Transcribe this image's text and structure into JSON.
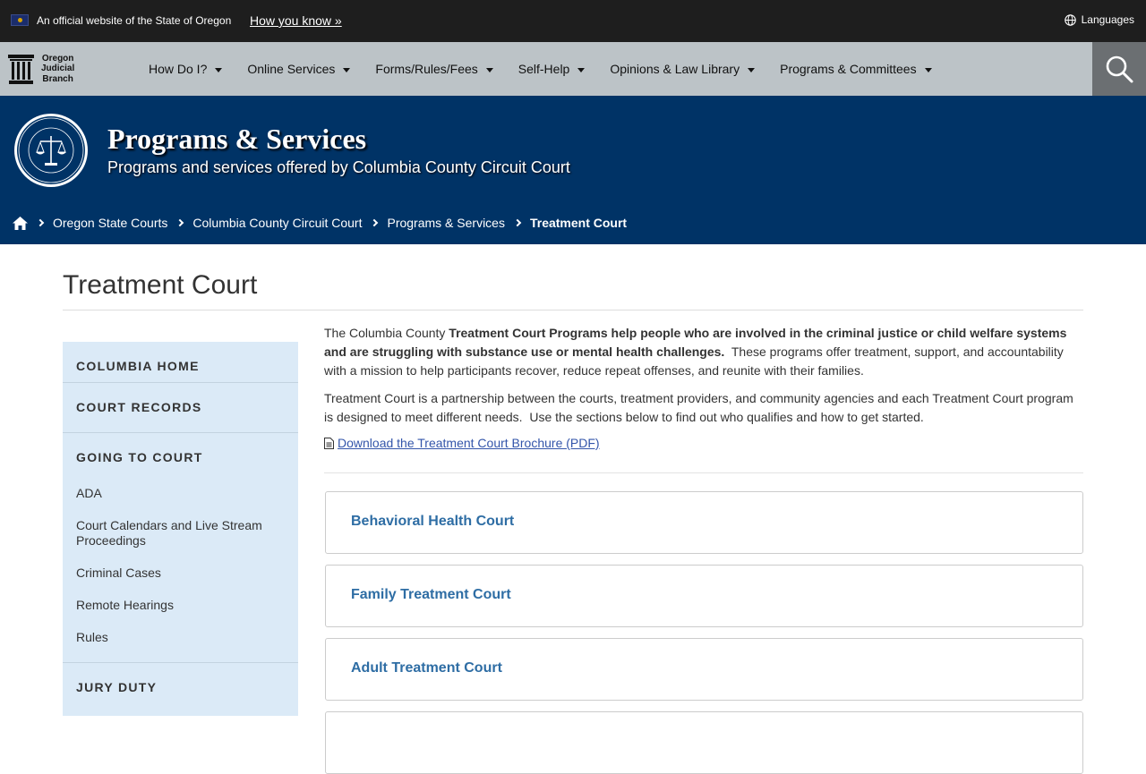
{
  "banner": {
    "official_text": "An official website of the State of Oregon",
    "how_link": "How you know »",
    "languages": "Languages"
  },
  "logo": {
    "line1": "Oregon",
    "line2": "Judicial",
    "line3": "Branch"
  },
  "nav": {
    "items": [
      {
        "label": "How Do I?"
      },
      {
        "label": "Online Services"
      },
      {
        "label": "Forms/Rules/Fees"
      },
      {
        "label": "Self-Help"
      },
      {
        "label": "Opinions & Law Library"
      },
      {
        "label": "Programs & Committees"
      }
    ]
  },
  "hero": {
    "title": "Programs & Services",
    "subtitle": "Programs and services offered by Columbia County Circuit Court"
  },
  "breadcrumb": {
    "items": [
      "Oregon State Courts",
      "Columbia County Circuit Court",
      "Programs & Services"
    ],
    "current": "Treatment Court"
  },
  "page": {
    "title": "Treatment Court"
  },
  "sidebar": {
    "columbia_home": "COLUMBIA HOME",
    "court_records": "COURT RECORDS",
    "going_to_court": "GOING TO COURT",
    "links": [
      "ADA",
      "Court Calendars and Live Stream Proceedings",
      "Criminal Cases",
      "Remote Hearings",
      "Rules"
    ],
    "jury_duty": "JURY DUTY"
  },
  "content": {
    "p1_pre": "The Columbia County ",
    "p1_bold": "Treatment Court Programs help people who are involved in the criminal justice or child welfare systems and are struggling with substance use or mental health challenges.",
    "p1_post": "  These programs offer treatment, support, and accountability with a mission to help participants recover, reduce repeat offenses, and reunite with their families.",
    "p2": "Treatment Court is a partnership between the courts, treatment providers, and community agencies and each Treatment Court program is designed to meet different needs.  Use the sections below to find out who qualifies and how to get started.",
    "pdf_link": "Download the Treatment Court Brochure (PDF)"
  },
  "panels": [
    "Behavioral Health Court",
    "Family Treatment Court",
    "Adult Treatment Court"
  ]
}
